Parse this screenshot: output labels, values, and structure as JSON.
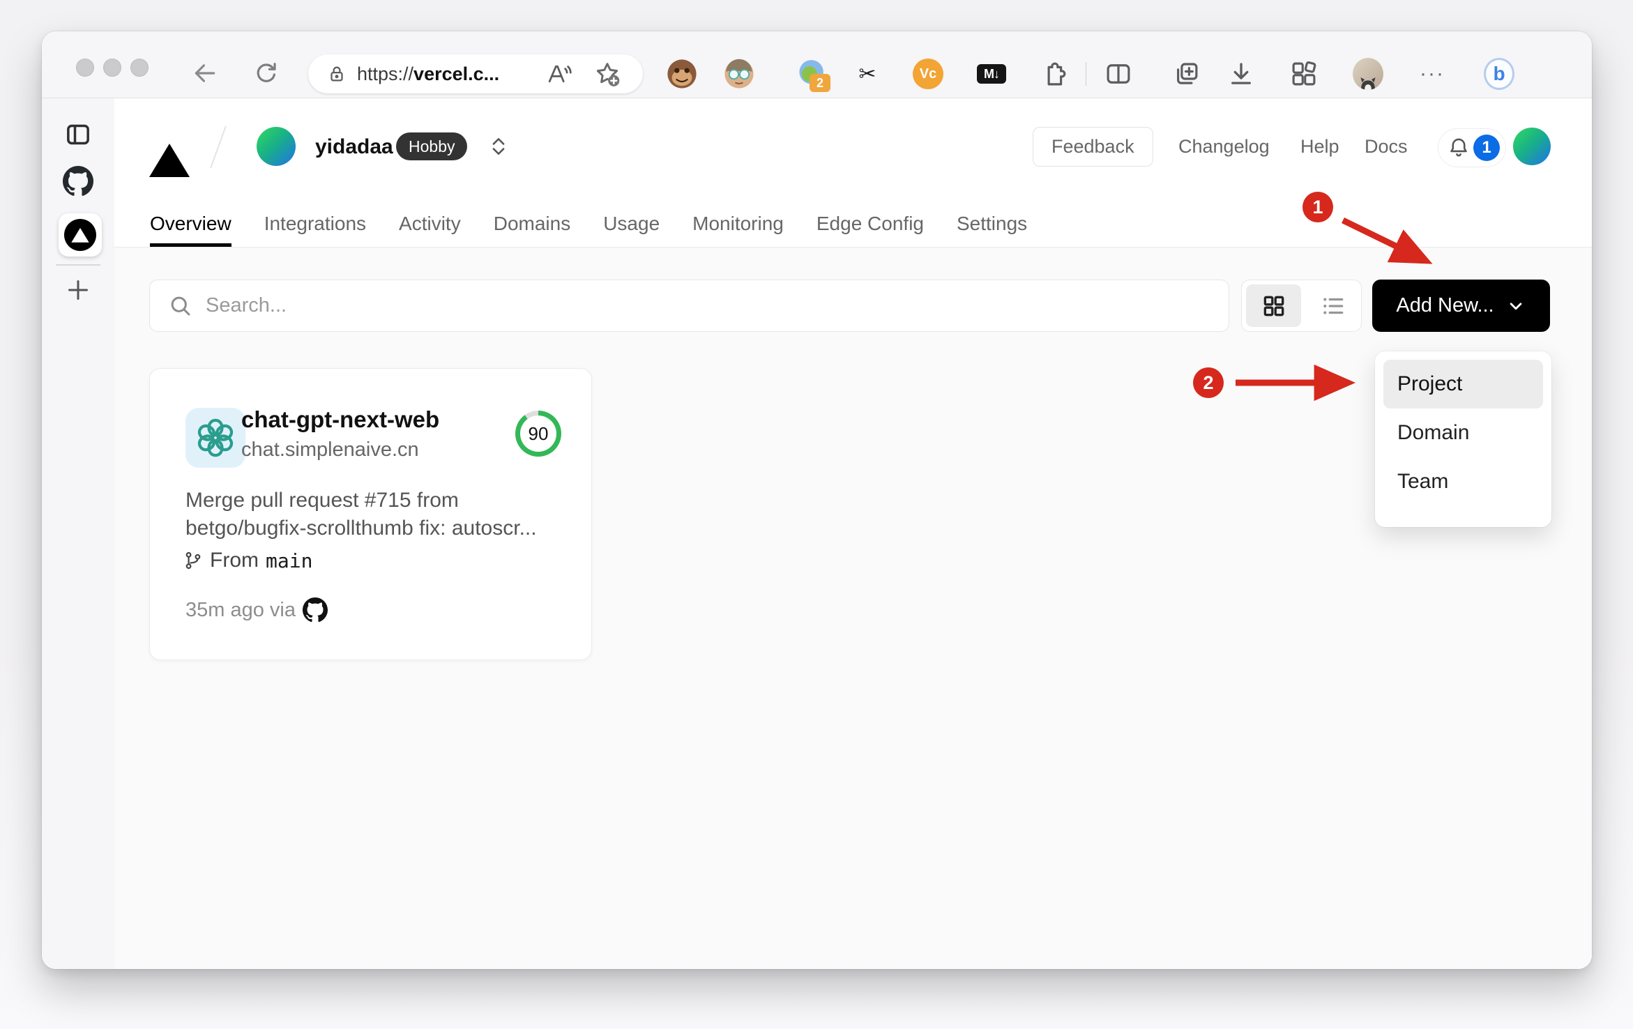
{
  "browser": {
    "url_scheme": "https://",
    "url_host": "vercel.c...",
    "extension_badge": "2",
    "vc_label": "Vc",
    "md_label": "M↓",
    "bing_label": "b",
    "more_glyph": "···",
    "scissors_glyph": "✂"
  },
  "header": {
    "team_name": "yidadaa",
    "team_plan": "Hobby",
    "feedback": "Feedback",
    "changelog": "Changelog",
    "help": "Help",
    "docs": "Docs",
    "notification_count": "1"
  },
  "nav": {
    "tabs": [
      "Overview",
      "Integrations",
      "Activity",
      "Domains",
      "Usage",
      "Monitoring",
      "Edge Config",
      "Settings"
    ]
  },
  "toolbar": {
    "search_placeholder": "Search...",
    "add_new": "Add New..."
  },
  "add_new_menu": {
    "items": [
      "Project",
      "Domain",
      "Team"
    ],
    "highlighted": "Project"
  },
  "project_card": {
    "name": "chat-gpt-next-web",
    "domain": "chat.simplenaive.cn",
    "score": "90",
    "commit_line1": "Merge pull request #715 from",
    "commit_line2": "betgo/bugfix-scrollthumb fix: autoscr...",
    "from_label": "From",
    "branch": "main",
    "deployed": "35m ago via"
  },
  "annotations": {
    "step1": "1",
    "step2": "2"
  },
  "colors": {
    "annotation_red": "#d6281d",
    "notification_blue": "#0b6ce5",
    "score_green": "#34b857",
    "brand_black": "#000000"
  }
}
